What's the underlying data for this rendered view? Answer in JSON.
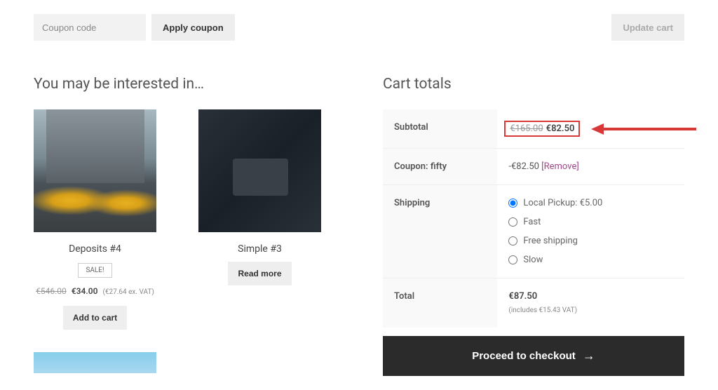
{
  "coupon": {
    "placeholder": "Coupon code",
    "apply_label": "Apply coupon",
    "update_label": "Update cart"
  },
  "upsell": {
    "title": "You may be interested in…",
    "products": [
      {
        "title": "Deposits #4",
        "sale_badge": "SALE!",
        "price_old": "€546.00",
        "price_new": "€34.00",
        "vat_note": "(€27.64 ex. VAT)",
        "button": "Add to cart"
      },
      {
        "title": "Simple #3",
        "button": "Read more"
      }
    ]
  },
  "totals": {
    "title": "Cart totals",
    "subtotal_label": "Subtotal",
    "subtotal_old": "€165.00",
    "subtotal_new": "€82.50",
    "coupon_label": "Coupon: fifty",
    "coupon_value": "-€82.50 ",
    "coupon_remove": "[Remove]",
    "shipping_label": "Shipping",
    "shipping_options": [
      {
        "label": "Local Pickup: €5.00",
        "checked": true
      },
      {
        "label": "Fast",
        "checked": false
      },
      {
        "label": "Free shipping",
        "checked": false
      },
      {
        "label": "Slow",
        "checked": false
      }
    ],
    "total_label": "Total",
    "total_value": "€87.50",
    "total_vat": "(includes €15.43 VAT)"
  },
  "checkout_label": "Proceed to checkout"
}
